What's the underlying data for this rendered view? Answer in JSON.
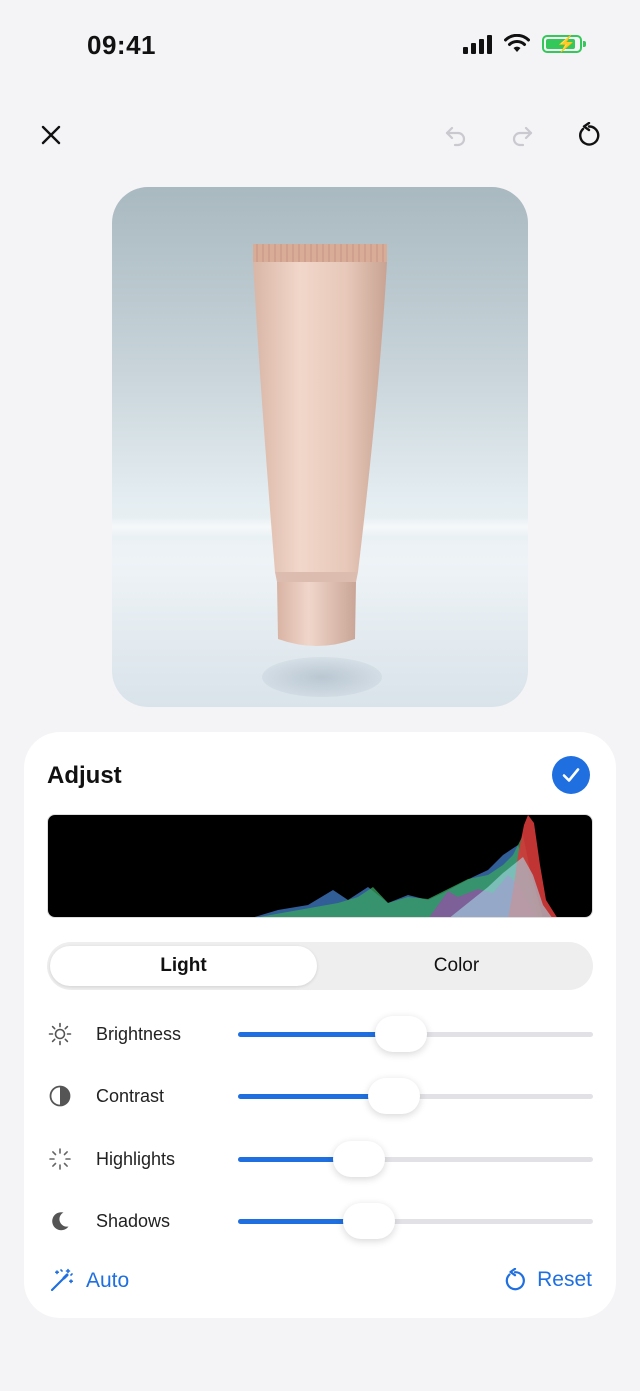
{
  "status": {
    "time": "09:41"
  },
  "toolbar": {
    "close_icon": "close-icon",
    "undo_icon": "undo-icon",
    "redo_icon": "redo-icon",
    "revert_icon": "revert-icon"
  },
  "photo": {
    "subject": "cream tube product photo"
  },
  "panel": {
    "title": "Adjust",
    "tabs": [
      {
        "label": "Light",
        "selected": true
      },
      {
        "label": "Color",
        "selected": false
      }
    ],
    "sliders": [
      {
        "label": "Brightness",
        "icon": "sun-icon",
        "value": 0.46
      },
      {
        "label": "Contrast",
        "icon": "contrast-icon",
        "value": 0.44
      },
      {
        "label": "Highlights",
        "icon": "highlights-icon",
        "value": 0.34
      },
      {
        "label": "Shadows",
        "icon": "moon-icon",
        "value": 0.37
      }
    ],
    "auto_label": "Auto",
    "reset_label": "Reset"
  },
  "colors": {
    "accent": "#1f6fe0",
    "battery": "#34c759"
  }
}
